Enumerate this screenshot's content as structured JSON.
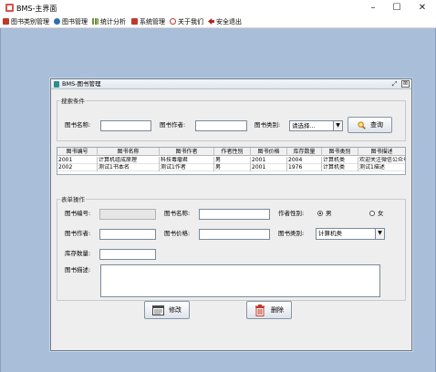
{
  "window": {
    "title": "BMS-主界面",
    "minimize_glyph": "–",
    "maximize_glyph": "☐",
    "close_glyph": "✕"
  },
  "menu": [
    {
      "label": "图书类别管理",
      "icon": "book-category-icon",
      "color": "#c0392b"
    },
    {
      "label": "图书管理",
      "icon": "book-icon",
      "color": "#2f6fb0"
    },
    {
      "label": "统计分析",
      "icon": "chart-icon",
      "color": "#6d8f3a"
    },
    {
      "label": "系统管理",
      "icon": "system-icon",
      "color": "#c0392b"
    },
    {
      "label": "关于我们",
      "icon": "info-icon",
      "color": "#c0392b"
    },
    {
      "label": "安全退出",
      "icon": "exit-icon",
      "color": "#b01f1f"
    }
  ],
  "internal_frame": {
    "title": "BMS-图书管理",
    "restore_glyph": "⤢",
    "close_glyph": "⊠"
  },
  "search": {
    "group_title": "搜索条件",
    "name_label": "图书名称:",
    "name_value": "",
    "author_label": "图书作者:",
    "author_value": "",
    "category_label": "图书类别:",
    "category_value": "请选择...",
    "query_button": "查询"
  },
  "table": {
    "columns": [
      "图书编号",
      "图书名称",
      "图书作者",
      "作者性别",
      "图书价格",
      "库存数量",
      "图书类别",
      "图书描述"
    ],
    "rows": [
      [
        "2001",
        "计算机组成原理",
        "科技毒瘤君",
        "男",
        "2001",
        "2004",
        "计算机类",
        "欢迎关注微信公众号..."
      ],
      [
        "2002",
        "测试1书本名",
        "测试1作者",
        "男",
        "2001",
        "1976",
        "计算机类",
        "测试1描述"
      ]
    ]
  },
  "form": {
    "group_title": "表单操作",
    "id_label": "图书编号:",
    "id_value": "",
    "name_label": "图书名称:",
    "name_value": "",
    "gender_label": "作者性别:",
    "gender_male": "男",
    "gender_female": "女",
    "gender_selected": "男",
    "author_label": "图书作者:",
    "author_value": "",
    "price_label": "图书价格:",
    "price_value": "",
    "category_label": "图书类别:",
    "category_value": "计算机类",
    "stock_label": "库存数量:",
    "stock_value": "",
    "desc_label": "图书描述:",
    "desc_value": "",
    "edit_button": "修改",
    "delete_button": "删除"
  }
}
